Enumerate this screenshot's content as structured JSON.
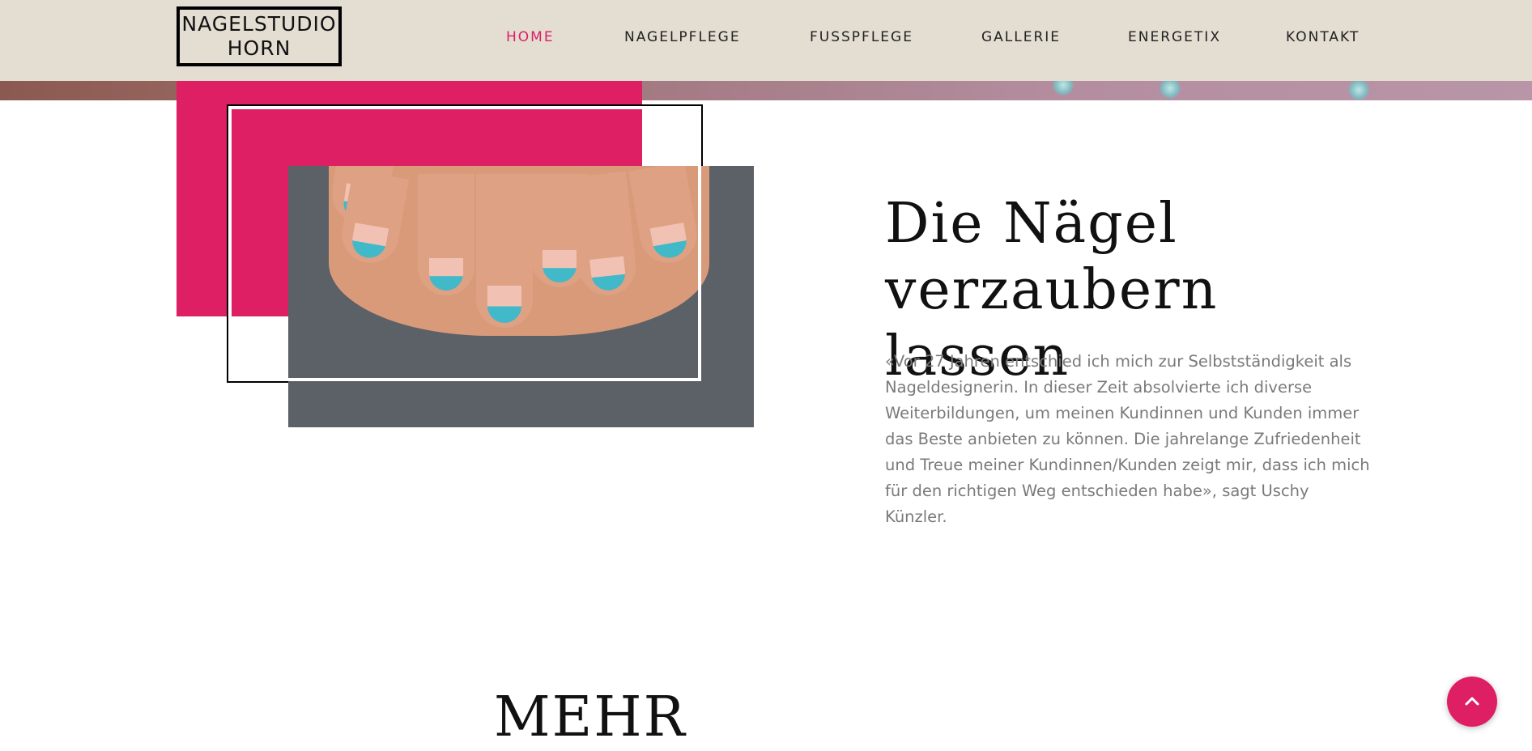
{
  "brand": {
    "logo_line1": "NAGELSTUDIO",
    "logo_line2": "HORN",
    "accent_color": "#de1f64",
    "header_bg": "#e3ddd2"
  },
  "nav": {
    "items": [
      {
        "label": "HOME",
        "active": true
      },
      {
        "label": "NAGELPFLEGE",
        "active": false
      },
      {
        "label": "FUSSPFLEGE",
        "active": false
      },
      {
        "label": "GALLERIE",
        "active": false
      },
      {
        "label": "ENERGETIX",
        "active": false
      },
      {
        "label": "KONTAKT",
        "active": false
      }
    ]
  },
  "intro": {
    "headline_line1": "Die Nägel",
    "headline_line2": "verzaubern lassen",
    "quote": "«Vor 27 Jahren entschied ich mich zur Selbstständigkeit als Nageldesignerin. In dieser Zeit absolvierte ich diverse Weiterbildungen, um meinen Kundinnen und Kunden immer das Beste anbieten zu können. Die jahrelange Zufriedenheit und Treue meiner Kundinnen/Kunden zeigt mir, dass ich mich für den richtigen Weg entschieden habe», sagt Uschy Künzler."
  },
  "more": {
    "heading": "MEHR"
  },
  "icons": {
    "scroll_top": "chevron-up-icon"
  }
}
